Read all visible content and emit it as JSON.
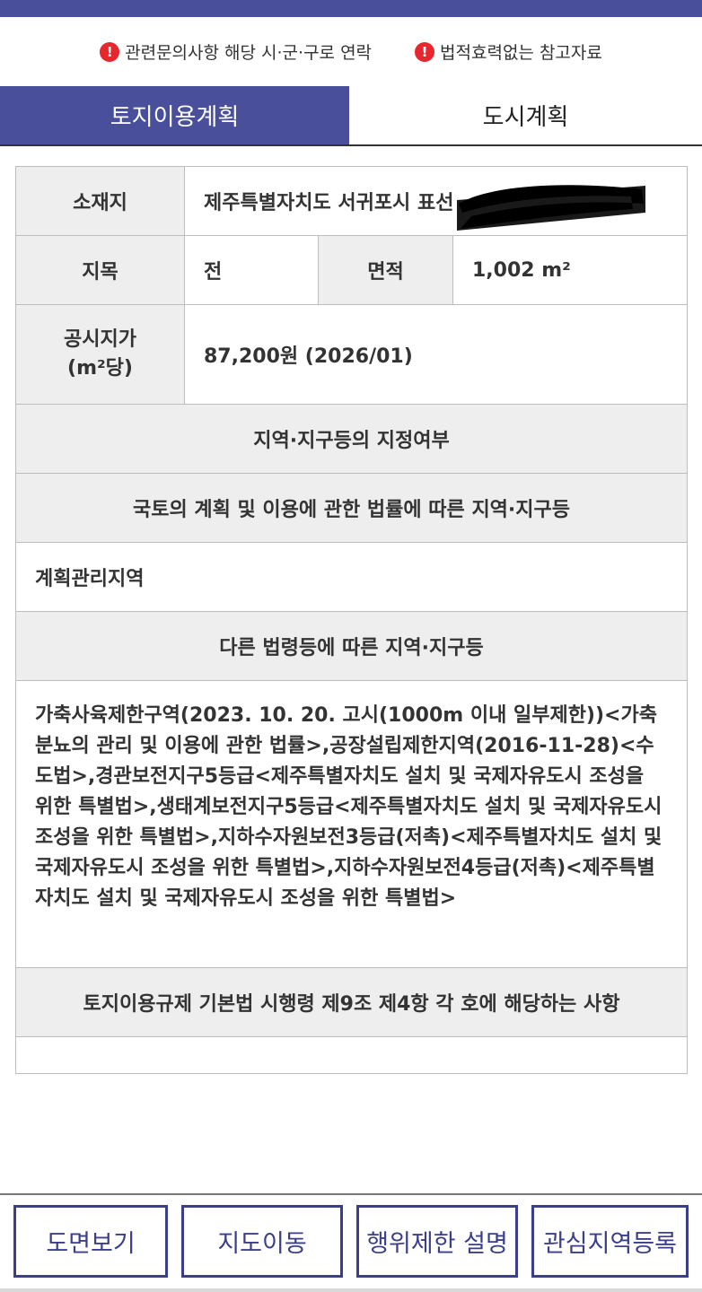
{
  "notices": [
    {
      "icon": "!",
      "text": "관련문의사항 해당 시·군·구로 연락"
    },
    {
      "icon": "!",
      "text": "법적효력없는 참고자료"
    }
  ],
  "tabs": [
    {
      "label": "토지이용계획"
    },
    {
      "label": "도시계획"
    }
  ],
  "info": {
    "location_label": "소재지",
    "location_value": "제주특별자치도 서귀포시 표선",
    "jimok_label": "지목",
    "jimok_value": "전",
    "area_label": "면적",
    "area_value": "1,002 m²",
    "price_label_1": "공시지가",
    "price_label_2": "(m²당)",
    "price_value": "87,200원 (2026/01)",
    "zoning_header": "지역·지구등의 지정여부",
    "national_header": "국토의 계획 및 이용에 관한 법률에 따른 지역·지구등",
    "national_value": "계획관리지역",
    "other_header": "다른 법령등에 따른 지역·지구등",
    "other_value": "가축사육제한구역(2023. 10. 20. 고시(1000m 이내 일부제한))<가축분뇨의 관리 및 이용에 관한 법률>,공장설립제한지역(2016-11-28)<수도법>,경관보전지구5등급<제주특별자치도 설치 및 국제자유도시 조성을 위한 특별법>,생태계보전지구5등급<제주특별자치도 설치 및 국제자유도시 조성을 위한 특별법>,지하수자원보전3등급(저촉)<제주특별자치도 설치 및 국제자유도시 조성을 위한 특별법>,지하수자원보전4등급(저촉)<제주특별자치도 설치 및 국제자유도시 조성을 위한 특별법>",
    "regulation_header": "토지이용규제 기본법 시행령 제9조 제4항 각 호에 해당하는 사항",
    "regulation_value": ""
  },
  "buttons": [
    {
      "label": "도면보기"
    },
    {
      "label": "지도이동"
    },
    {
      "label": "행위제한 설명"
    },
    {
      "label": "관심지역등록"
    }
  ],
  "colors": {
    "brand": "#4a4f9c",
    "button_border": "#3b3f8a",
    "warning": "#e8262e",
    "header_bg": "#eeeeee"
  }
}
